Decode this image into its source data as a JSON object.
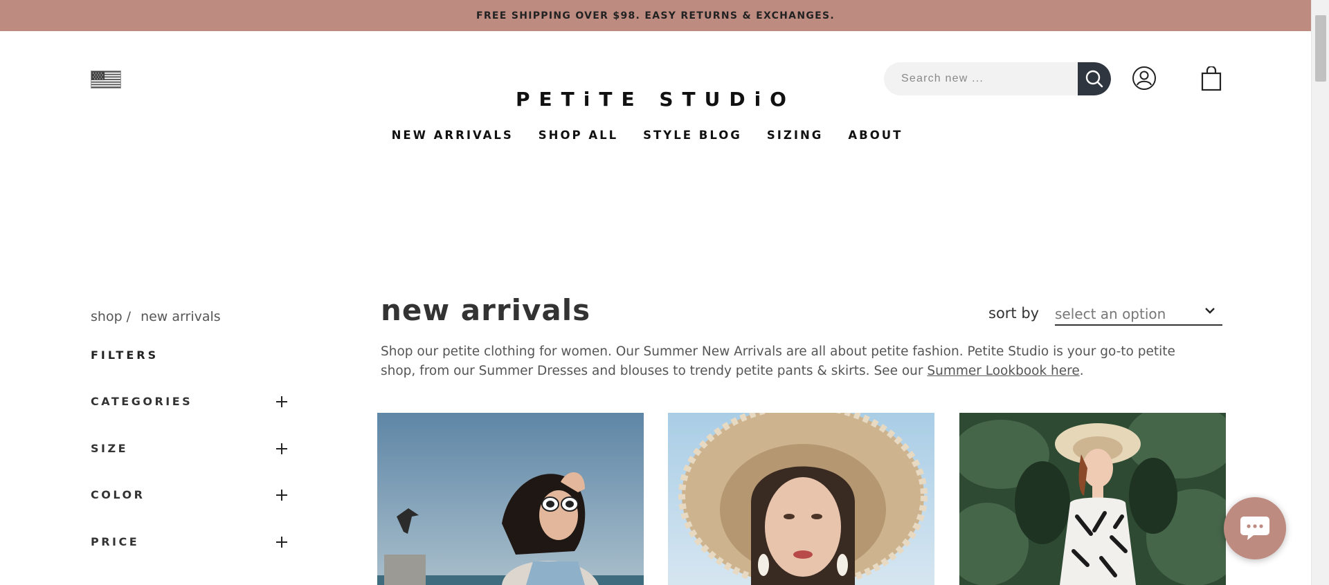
{
  "colors": {
    "accent": "#be8b81",
    "search_button": "#2f3640",
    "text": "#222222"
  },
  "announcement": {
    "text": "FREE SHIPPING OVER $98. EASY RETURNS & EXCHANGES."
  },
  "header": {
    "country_flag": "us-flag-icon",
    "logo": "PETiTE STUDiO",
    "search": {
      "placeholder": "Search new ...",
      "value": "",
      "button_icon": "search-icon"
    },
    "account_icon": "user-icon",
    "cart_icon": "shopping-bag-icon"
  },
  "nav": {
    "items": [
      {
        "label": "NEW ARRIVALS"
      },
      {
        "label": "SHOP ALL"
      },
      {
        "label": "STYLE BLOG"
      },
      {
        "label": "SIZING"
      },
      {
        "label": "ABOUT"
      }
    ]
  },
  "breadcrumb": {
    "parent": "shop /",
    "current": "new arrivals"
  },
  "filters": {
    "title": "FILTERS",
    "groups": [
      {
        "label": "CATEGORIES",
        "icon": "plus-icon"
      },
      {
        "label": "SIZE",
        "icon": "plus-icon"
      },
      {
        "label": "COLOR",
        "icon": "plus-icon"
      },
      {
        "label": "PRICE",
        "icon": "plus-icon"
      }
    ]
  },
  "main": {
    "title": "new arrivals",
    "sort": {
      "label": "sort by",
      "selected": "select an option"
    },
    "intro": {
      "text": "Shop our petite clothing for women. Our Summer New Arrivals are all about petite fashion. Petite Studio is your go-to petite shop, from our Summer Dresses and blouses to trendy petite pants & skirts.  See our ",
      "link": "Summer Lookbook here",
      "after": "."
    },
    "products": [
      {
        "image": "woman-in-sunglasses-by-the-sea-photo"
      },
      {
        "image": "woman-in-straw-hat-photo"
      },
      {
        "image": "woman-in-sun-hat-and-print-dress-photo"
      }
    ]
  },
  "chat": {
    "icon": "chat-bubble-icon"
  }
}
